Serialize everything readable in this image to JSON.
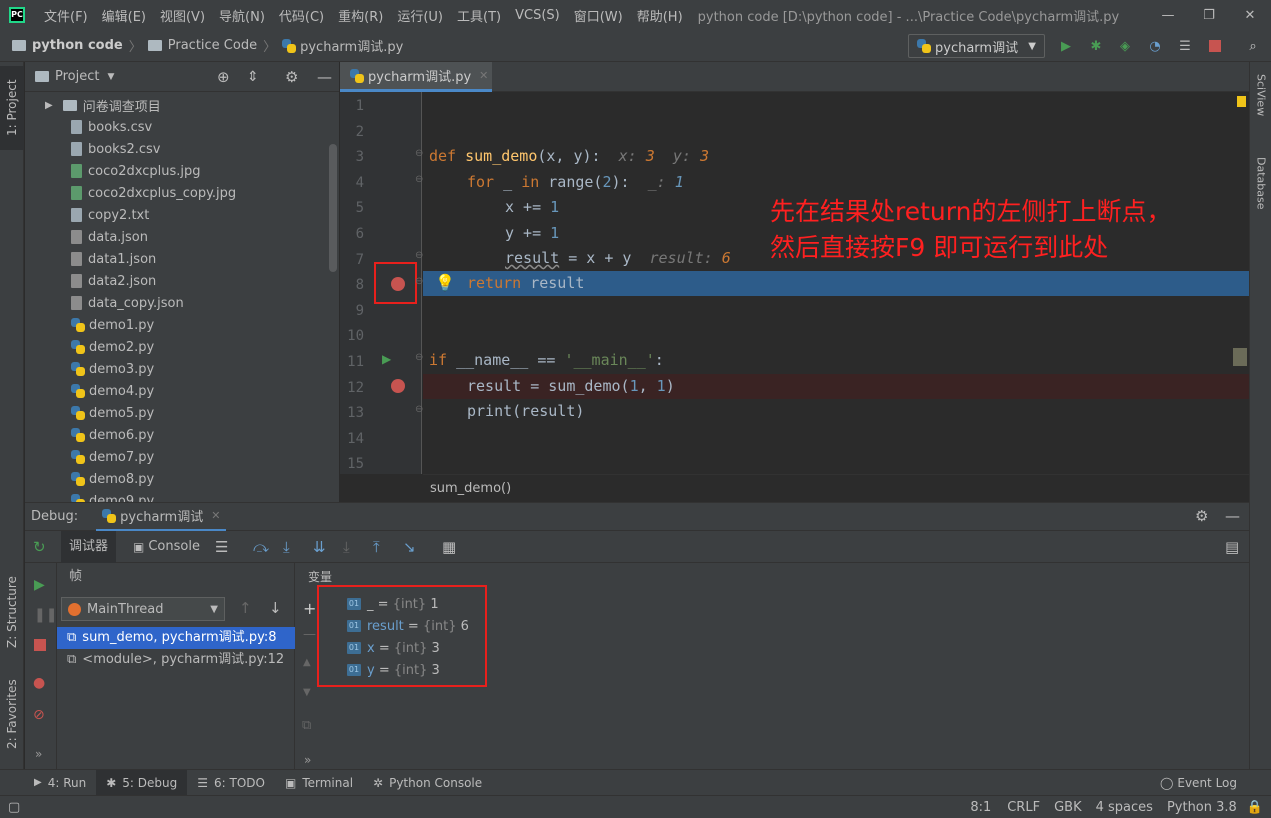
{
  "menubar": {
    "items": [
      "文件(F)",
      "编辑(E)",
      "视图(V)",
      "导航(N)",
      "代码(C)",
      "重构(R)",
      "运行(U)",
      "工具(T)",
      "VCS(S)",
      "窗口(W)",
      "帮助(H)"
    ],
    "title": "python code [D:\\python code] - ...\\Practice Code\\pycharm调试.py"
  },
  "navbar": {
    "crumbs": [
      "python code",
      "Practice Code",
      "pycharm调试.py"
    ],
    "run_config": "pycharm调试"
  },
  "left_stripe": {
    "project_tab": "1: Project",
    "structure_tab": "Z: Structure",
    "favorites_tab": "2: Favorites"
  },
  "right_stripe": {
    "sciview_tab": "SciView",
    "database_tab": "Database"
  },
  "project": {
    "title": "Project",
    "folder": "问卷调查项目",
    "files": [
      {
        "name": "books.csv",
        "type": "csv"
      },
      {
        "name": "books2.csv",
        "type": "csv"
      },
      {
        "name": "coco2dxcplus.jpg",
        "type": "img"
      },
      {
        "name": "coco2dxcplus_copy.jpg",
        "type": "img"
      },
      {
        "name": "copy2.txt",
        "type": "txt"
      },
      {
        "name": "data.json",
        "type": "json"
      },
      {
        "name": "data1.json",
        "type": "json"
      },
      {
        "name": "data2.json",
        "type": "json"
      },
      {
        "name": "data_copy.json",
        "type": "json"
      },
      {
        "name": "demo1.py",
        "type": "py"
      },
      {
        "name": "demo2.py",
        "type": "py"
      },
      {
        "name": "demo3.py",
        "type": "py"
      },
      {
        "name": "demo4.py",
        "type": "py"
      },
      {
        "name": "demo5.py",
        "type": "py"
      },
      {
        "name": "demo6.py",
        "type": "py"
      },
      {
        "name": "demo7.py",
        "type": "py"
      },
      {
        "name": "demo8.py",
        "type": "py"
      },
      {
        "name": "demo9.py",
        "type": "py"
      }
    ]
  },
  "editor": {
    "tab": "pycharm调试.py",
    "line_numbers": [
      "1",
      "2",
      "3",
      "4",
      "5",
      "6",
      "7",
      "8",
      "9",
      "10",
      "11",
      "12",
      "13",
      "14",
      "15"
    ],
    "code": {
      "l3_def": "def ",
      "l3_fn": "sum_demo",
      "l3_args": "(x, y):",
      "l3_hint1": "x: ",
      "l3_hint1v": "3",
      "l3_hint2": "y: ",
      "l3_hint2v": "3",
      "l4_for": "for",
      "l4_var": " _ ",
      "l4_in": "in",
      "l4_range": " range(",
      "l4_num": "2",
      "l4_end": "):",
      "l4_hint": "_: ",
      "l4_hintv": "1",
      "l5_a": "x += ",
      "l5_n": "1",
      "l6_a": "y += ",
      "l6_n": "1",
      "l7_a": "result",
      "l7_b": " = x + y",
      "l7_hint": "result: ",
      "l7_hintv": "6",
      "l8_kw": "return",
      "l8_b": " result",
      "l11_if": "if",
      "l11_b": " __name__ == ",
      "l11_s": "'__main__'",
      "l11_c": ":",
      "l12_a": "result = sum_demo(",
      "l12_n1": "1",
      "l12_c": ", ",
      "l12_n2": "1",
      "l12_e": ")",
      "l13": "print(result)"
    },
    "breadcrumb": "sum_demo()",
    "annotation_line1": "先在结果处return的左侧打上断点，",
    "annotation_line2": "然后直接按F9 即可运行到此处"
  },
  "debug": {
    "label": "Debug:",
    "session_tab": "pycharm调试",
    "tab_debugger": "调试器",
    "tab_console": "Console",
    "frames_header": "帧",
    "variables_header": "变量",
    "thread": "MainThread",
    "frames": [
      "sum_demo, pycharm调试.py:8",
      "<module>, pycharm调试.py:12"
    ],
    "variables": [
      {
        "name": "_",
        "type": "{int}",
        "value": "1"
      },
      {
        "name": "result",
        "type": "{int}",
        "value": "6"
      },
      {
        "name": "x",
        "type": "{int}",
        "value": "3"
      },
      {
        "name": "y",
        "type": "{int}",
        "value": "3"
      }
    ]
  },
  "bottom_tabs": {
    "run": "4: Run",
    "debug": "5: Debug",
    "todo": "6: TODO",
    "terminal": "Terminal",
    "python_console": "Python Console",
    "event_log": "Event Log"
  },
  "status": {
    "position": "8:1",
    "line_sep": "CRLF",
    "encoding": "GBK",
    "indent": "4 spaces",
    "interpreter": "Python 3.8"
  }
}
